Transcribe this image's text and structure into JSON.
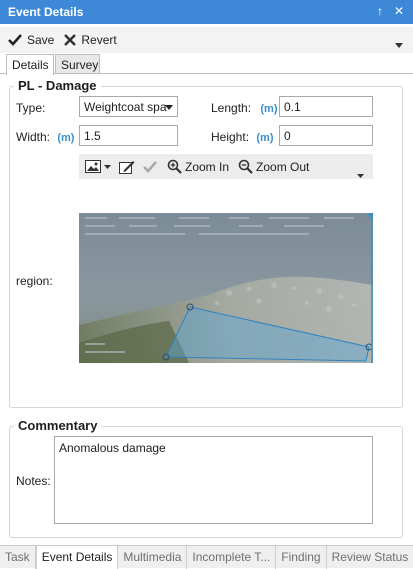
{
  "window": {
    "title": "Event Details",
    "pin_glyph": "↑",
    "close_glyph": "✕"
  },
  "toolbar": {
    "save_label": "Save",
    "revert_label": "Revert"
  },
  "tabs": [
    {
      "label": "Details",
      "active": true
    },
    {
      "label": "Survey",
      "active": false
    }
  ],
  "damage_group": {
    "title": "PL - Damage",
    "type_label": "Type:",
    "type_value": "Weightcoat spa",
    "length_label": "Length:",
    "length_unit": "(m)",
    "length_value": "0.1",
    "width_label": "Width:",
    "width_unit": "(m)",
    "width_value": "1.5",
    "height_label": "Height:",
    "height_unit": "(m)",
    "height_value": "0",
    "region_label": "region:"
  },
  "image_toolbar": {
    "zoom_in_label": "Zoom In",
    "zoom_out_label": "Zoom Out"
  },
  "commentary_group": {
    "title": "Commentary",
    "notes_label": "Notes:",
    "notes_value": "Anomalous damage"
  },
  "bottom_tabs": [
    {
      "label": "Task",
      "active": false
    },
    {
      "label": "Event Details",
      "active": true
    },
    {
      "label": "Multimedia",
      "active": false
    },
    {
      "label": "Incomplete T...",
      "active": false
    },
    {
      "label": "Finding",
      "active": false
    },
    {
      "label": "Review Status",
      "active": false
    }
  ],
  "colors": {
    "titlebar": "#3d89d8",
    "unit": "#3a8fc9",
    "region_overlay": "#5aa6d8"
  }
}
